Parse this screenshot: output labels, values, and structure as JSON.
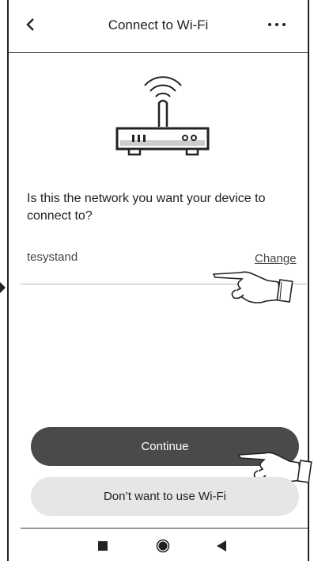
{
  "header": {
    "title": "Connect to Wi-Fi",
    "back_icon": "chevron-left-icon",
    "more_icon": "more-horizontal-icon"
  },
  "illustration": {
    "icon": "wifi-router-icon"
  },
  "prompt": {
    "question": "Is this the network you want your device to connect to?"
  },
  "network": {
    "name": "tesystand",
    "change_label": "Change"
  },
  "actions": {
    "continue_label": "Continue",
    "no_wifi_label": "Don’t want to use Wi-Fi"
  },
  "system_nav": {
    "recents_icon": "square-icon",
    "home_icon": "circle-icon",
    "back_icon": "triangle-back-icon"
  },
  "colors": {
    "primary_button": "#4a4a4a",
    "secondary_button": "#e6e6e6"
  }
}
